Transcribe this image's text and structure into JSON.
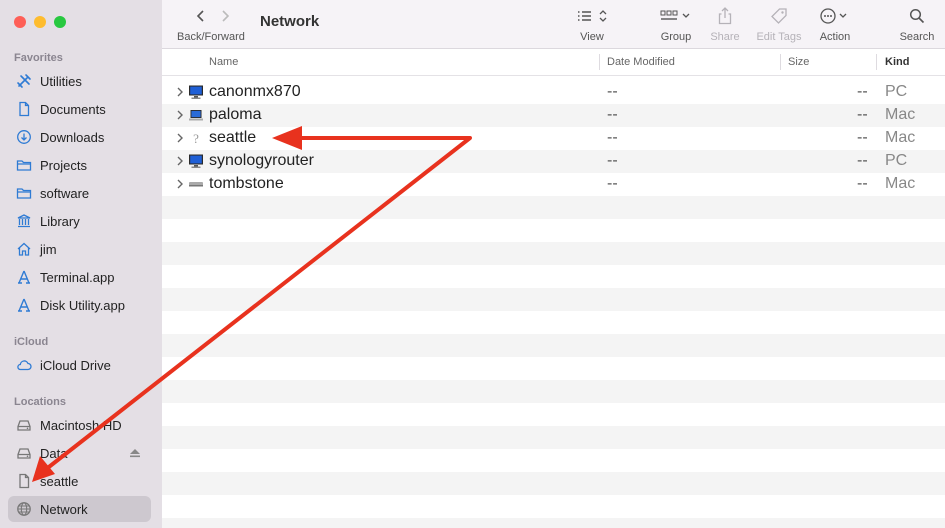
{
  "window": {
    "title": "Network"
  },
  "toolbar": {
    "back_forward_label": "Back/Forward",
    "view_label": "View",
    "group_label": "Group",
    "share_label": "Share",
    "edit_tags_label": "Edit Tags",
    "action_label": "Action",
    "search_label": "Search"
  },
  "sidebar": {
    "favorites_header": "Favorites",
    "favorites": [
      {
        "label": "Utilities",
        "icon": "utilities-icon"
      },
      {
        "label": "Documents",
        "icon": "document-icon"
      },
      {
        "label": "Downloads",
        "icon": "download-icon"
      },
      {
        "label": "Projects",
        "icon": "folder-icon"
      },
      {
        "label": "software",
        "icon": "folder-icon"
      },
      {
        "label": "Library",
        "icon": "library-icon"
      },
      {
        "label": "jim",
        "icon": "home-icon"
      },
      {
        "label": "Terminal.app",
        "icon": "app-icon"
      },
      {
        "label": "Disk Utility.app",
        "icon": "app-icon"
      }
    ],
    "icloud_header": "iCloud",
    "icloud": [
      {
        "label": "iCloud Drive",
        "icon": "cloud-icon"
      }
    ],
    "locations_header": "Locations",
    "locations": [
      {
        "label": "Macintosh HD",
        "icon": "disk-icon"
      },
      {
        "label": "Data",
        "icon": "disk-icon"
      },
      {
        "label": "seattle",
        "icon": "file-icon"
      },
      {
        "label": "Network",
        "icon": "globe-icon",
        "selected": true
      }
    ]
  },
  "list": {
    "columns": {
      "name": "Name",
      "date_modified": "Date Modified",
      "size": "Size",
      "kind": "Kind"
    },
    "rows": [
      {
        "name": "canonmx870",
        "date": "--",
        "size": "--",
        "kind": "PC",
        "icon": "pc-monitor-icon"
      },
      {
        "name": "paloma",
        "date": "--",
        "size": "--",
        "kind": "Mac",
        "icon": "laptop-icon"
      },
      {
        "name": "seattle",
        "date": "--",
        "size": "--",
        "kind": "Mac",
        "icon": "question-icon"
      },
      {
        "name": "synologyrouter",
        "date": "--",
        "size": "--",
        "kind": "PC",
        "icon": "pc-monitor-icon"
      },
      {
        "name": "tombstone",
        "date": "--",
        "size": "--",
        "kind": "Mac",
        "icon": "mac-mini-icon"
      }
    ]
  },
  "colors": {
    "sidebar_bg": "#e4dfe5",
    "accent": "#2f7bd4",
    "annotation_arrow": "#e8321e",
    "traffic_close": "#fe5f57",
    "traffic_minimize": "#febc2e",
    "traffic_zoom": "#28c840"
  }
}
